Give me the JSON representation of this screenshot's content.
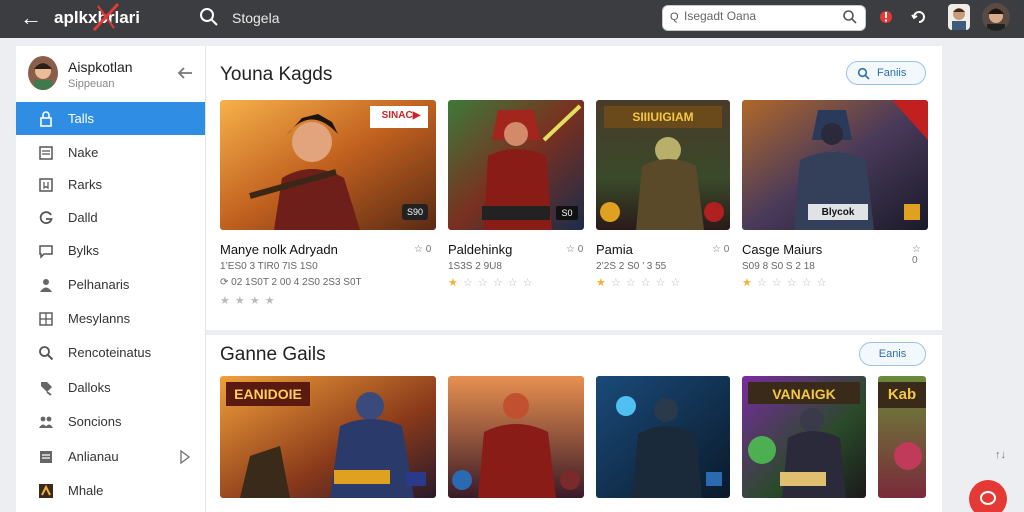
{
  "topbar": {
    "brand": "aplkxbrlari",
    "search_label": "Stogela",
    "search_input_lead": "Q",
    "search_input_value": "Isegadt Oana"
  },
  "sidebar": {
    "profile_name": "Aispkotlan",
    "profile_sub": "Sippeuan",
    "items": [
      {
        "label": "Talls",
        "icon": "lock-icon",
        "active": true
      },
      {
        "label": "Nake",
        "icon": "list-icon"
      },
      {
        "label": "Rarks",
        "icon": "bookmark-icon"
      },
      {
        "label": "Dalld",
        "icon": "g-icon"
      },
      {
        "label": "Bylks",
        "icon": "chat-icon"
      },
      {
        "label": "Pelhanaris",
        "icon": "person-icon"
      },
      {
        "label": "Mesylanns",
        "icon": "grid-icon"
      },
      {
        "label": "Rencoteinatus",
        "icon": "search-icon"
      },
      {
        "label": "Dalloks",
        "icon": "tag-icon"
      },
      {
        "label": "Soncions",
        "icon": "people-icon"
      },
      {
        "label": "Anlianau",
        "icon": "document-icon"
      },
      {
        "label": "Mhale",
        "icon": "app-icon"
      }
    ]
  },
  "sections": [
    {
      "title": "Youna Kagds",
      "button_label": "Faniis",
      "cards": [
        {
          "title": "Manye nolk Adryadn",
          "meta": "☆ 0",
          "line1": "1’ES0 3 TIR0  7IS 1S0",
          "line2": "⟳ 02 1S0T 2 00 4 2S0 2S3 S0T",
          "badge": "S90",
          "banner": "SINAC▶",
          "rating": 0
        },
        {
          "title": "Paldehinkg",
          "meta": "☆ 0",
          "line1": "1S3S 2 9U8",
          "badge": "S0",
          "banner": "",
          "stars_text": "★ ☆ ☆ ☆ ☆ ★’",
          "rating": 1
        },
        {
          "title": "Pamia",
          "meta": "☆ 0",
          "line1": "2’2S 2 S0 ’ 3 55",
          "badge": "",
          "banner": "SIIIUIGIAM",
          "stars_text": "★ ☆ ☆ ☆ ☆ ☆ 1",
          "rating": 1
        },
        {
          "title": "Casge Maiurs",
          "meta": "☆ 0",
          "line1": "S09 8 S0 S 2 18",
          "badge": "",
          "banner": "Blycok",
          "stars_text": "★ ☆ ☆ ☆ ☆ ☆ 6",
          "rating": 1
        }
      ]
    },
    {
      "title": "Ganne Gails",
      "button_label": "Eanis",
      "cards": [
        {
          "banner": "EANIDOIE",
          "badge": ""
        },
        {
          "banner": "",
          "badge": ""
        },
        {
          "banner": "",
          "badge": ""
        },
        {
          "banner": "VANAIGK",
          "badge": ""
        },
        {
          "banner": "Kab",
          "badge": ""
        }
      ]
    }
  ],
  "colors": {
    "accent": "#2f8ee3",
    "topbar": "#3c3d40",
    "star": "#f2b233",
    "fab": "#e53935"
  },
  "misc": {
    "scroll_hint": "↑↓"
  }
}
